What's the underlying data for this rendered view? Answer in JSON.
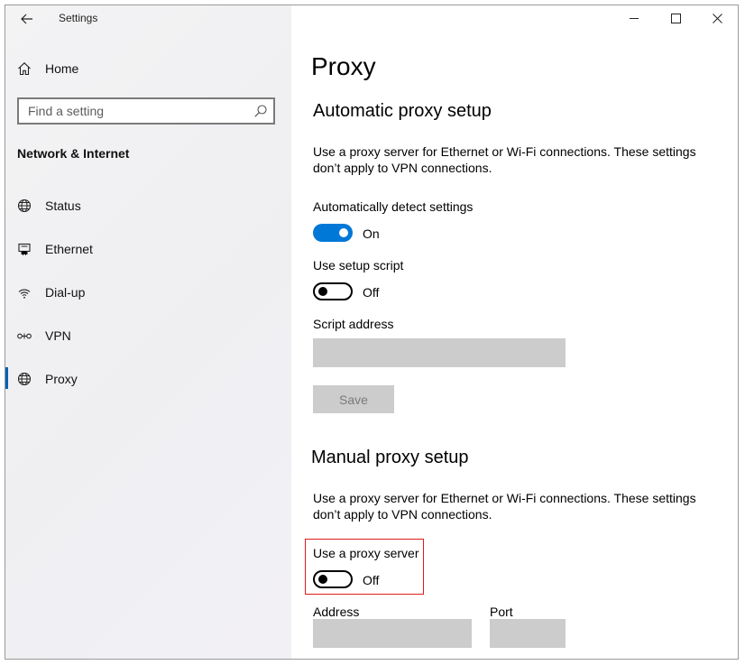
{
  "window": {
    "title": "Settings",
    "minimize_glyph": "—",
    "maximize_glyph": "☐",
    "close_glyph": "✕"
  },
  "sidebar": {
    "home": {
      "label": "Home",
      "icon": "home-icon"
    },
    "search": {
      "placeholder": "Find a setting",
      "icon": "search-icon"
    },
    "section_title": "Network & Internet",
    "items": [
      {
        "label": "Status",
        "icon": "globe-status-icon",
        "selected": false
      },
      {
        "label": "Ethernet",
        "icon": "ethernet-icon",
        "selected": false
      },
      {
        "label": "Dial-up",
        "icon": "dialup-icon",
        "selected": false
      },
      {
        "label": "VPN",
        "icon": "vpn-icon",
        "selected": false
      },
      {
        "label": "Proxy",
        "icon": "globe-icon",
        "selected": true
      }
    ],
    "accent_color": "#0063b1"
  },
  "main": {
    "page_title": "Proxy",
    "automatic": {
      "heading": "Automatic proxy setup",
      "description": "Use a proxy server for Ethernet or Wi-Fi connections. These settings don’t apply to VPN connections.",
      "detect": {
        "label": "Automatically detect settings",
        "state": "On",
        "on": true
      },
      "script": {
        "label": "Use setup script",
        "state": "Off",
        "on": false
      },
      "script_address": {
        "label": "Script address",
        "value": ""
      },
      "save_label": "Save"
    },
    "manual": {
      "heading": "Manual proxy setup",
      "description": "Use a proxy server for Ethernet or Wi-Fi connections. These settings don’t apply to VPN connections.",
      "use_proxy": {
        "label": "Use a proxy server",
        "state": "Off",
        "on": false
      },
      "address": {
        "label": "Address",
        "value": ""
      },
      "port": {
        "label": "Port",
        "value": ""
      }
    },
    "toggle_on_color": "#0078d7",
    "highlight_color": "#e01b1b"
  }
}
